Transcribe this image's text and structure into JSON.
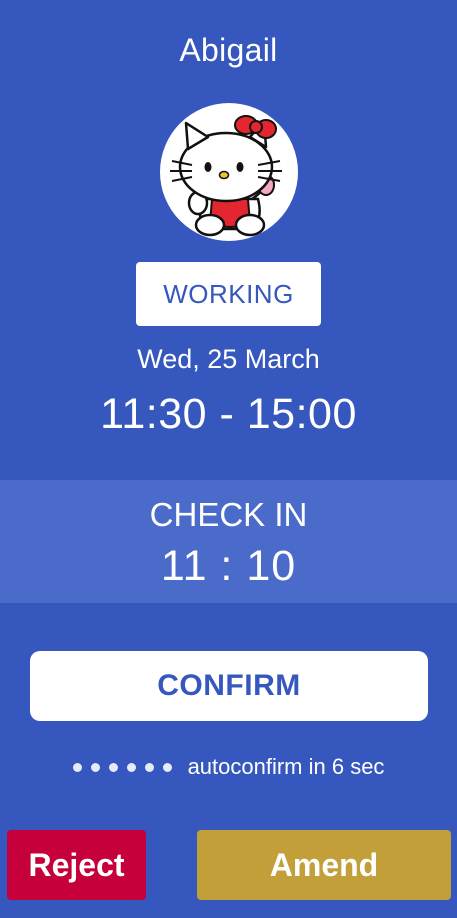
{
  "employee": {
    "name": "Abigail",
    "avatar_icon": "hello-kitty-avatar-icon"
  },
  "shift": {
    "status": "WORKING",
    "date": "Wed, 25 March",
    "time_range": "11:30 - 15:00"
  },
  "check_in": {
    "label": "CHECK IN",
    "time": "11 : 10"
  },
  "actions": {
    "confirm_label": "CONFIRM",
    "autoconfirm_text": "autoconfirm in 6 sec",
    "countdown_dots": 6,
    "reject_label": "Reject",
    "amend_label": "Amend"
  },
  "colors": {
    "background": "#3557be",
    "check_in_band": "#4a6bc9",
    "reject": "#c5003a",
    "amend": "#c39f3a"
  }
}
